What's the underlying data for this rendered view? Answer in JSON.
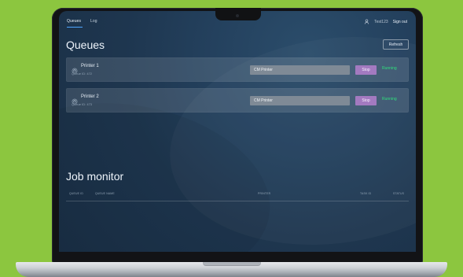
{
  "app": {
    "tabs": [
      {
        "label": "Queues"
      },
      {
        "label": "Log"
      }
    ],
    "user": {
      "name": "Test123",
      "signout_label": "Sign out"
    },
    "title": "Queues",
    "refresh_label": "Refresh",
    "queues": [
      {
        "name": "Printer 1",
        "id_text": "Queue ID: 472",
        "printer_value": "CM Printer",
        "stop_label": "Stop",
        "status": "Running"
      },
      {
        "name": "Printer 2",
        "id_text": "Queue ID: 473",
        "printer_value": "CM Printer",
        "stop_label": "Stop",
        "status": "Running"
      }
    ],
    "job_monitor": {
      "title": "Job monitor",
      "columns": [
        "QUEUE ID",
        "QUEUE NAME",
        "PRINTER",
        "TASK ID",
        "STATUS"
      ]
    }
  },
  "colors": {
    "background": "#8cc63f",
    "screen": "#223c58",
    "accent": "#4da6ff",
    "stop_button": "#a37ac0",
    "status": "#2fe07d"
  },
  "icons": {
    "user": "user-icon",
    "queue": "printer-icon"
  }
}
